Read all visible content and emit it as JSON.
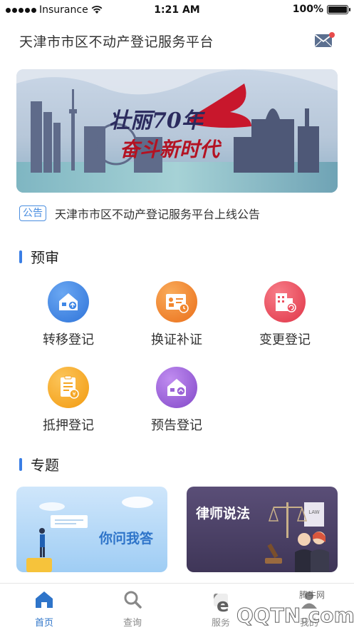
{
  "status_bar": {
    "carrier": "Insurance",
    "time": "1:21 AM",
    "battery": "100%",
    "battery_level": 1.0
  },
  "header": {
    "title": "天津市市区不动产登记服务平台",
    "mail_icon": "mail-icon"
  },
  "banner": {
    "line1": "壮丽70年",
    "line2": "奋斗新时代"
  },
  "notice": {
    "tag": "公告",
    "text": "天津市市区不动产登记服务平台上线公告"
  },
  "sections": {
    "preview": {
      "title": "预审"
    },
    "topics": {
      "title": "专题"
    }
  },
  "services": [
    {
      "label": "转移登记",
      "icon": "house-transfer-icon",
      "color": "#3f87e6"
    },
    {
      "label": "换证补证",
      "icon": "certificate-icon",
      "color": "#f2872f"
    },
    {
      "label": "变更登记",
      "icon": "building-change-icon",
      "color": "#ec5060"
    },
    {
      "label": "抵押登记",
      "icon": "mortgage-document-icon",
      "color": "#f5a623"
    },
    {
      "label": "预告登记",
      "icon": "house-notice-icon",
      "color": "#9a63d6"
    }
  ],
  "topics": [
    {
      "title": "你问我答"
    },
    {
      "title": "律师说法"
    }
  ],
  "tabs": [
    {
      "label": "首页",
      "icon": "home-icon",
      "active": true
    },
    {
      "label": "查询",
      "icon": "search-icon",
      "active": false
    },
    {
      "label": "服务",
      "icon": "service-icon",
      "active": false
    },
    {
      "label": "我的",
      "icon": "user-icon",
      "active": false
    }
  ],
  "watermark": {
    "site": "QQTN.com",
    "tag": "腾牛网"
  },
  "colors": {
    "accent": "#3a7ee5",
    "tab_active": "#2e74c9"
  }
}
